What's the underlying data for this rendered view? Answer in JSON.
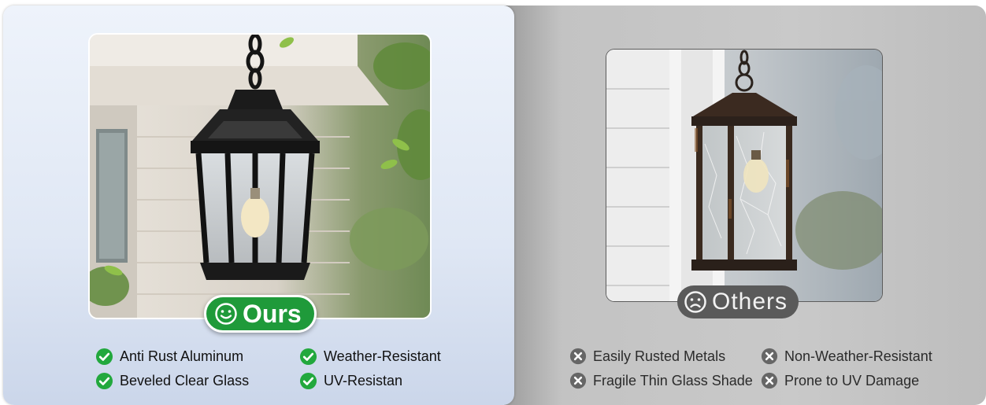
{
  "ours": {
    "badge_label": "Ours",
    "features": [
      "Anti Rust Aluminum",
      "Weather-Resistant",
      "Beveled Clear Glass",
      "UV-Resistan"
    ],
    "accent_color": "#1f9a3a",
    "badge_icon": "smile-icon",
    "feature_icon": "check-circle-icon"
  },
  "others": {
    "badge_label": "Others",
    "features": [
      "Easily Rusted Metals",
      "Non-Weather-Resistant",
      "Fragile Thin Glass Shade",
      "Prone to UV Damage"
    ],
    "accent_color": "#5a5a5a",
    "badge_icon": "frown-icon",
    "feature_icon": "x-circle-icon"
  }
}
